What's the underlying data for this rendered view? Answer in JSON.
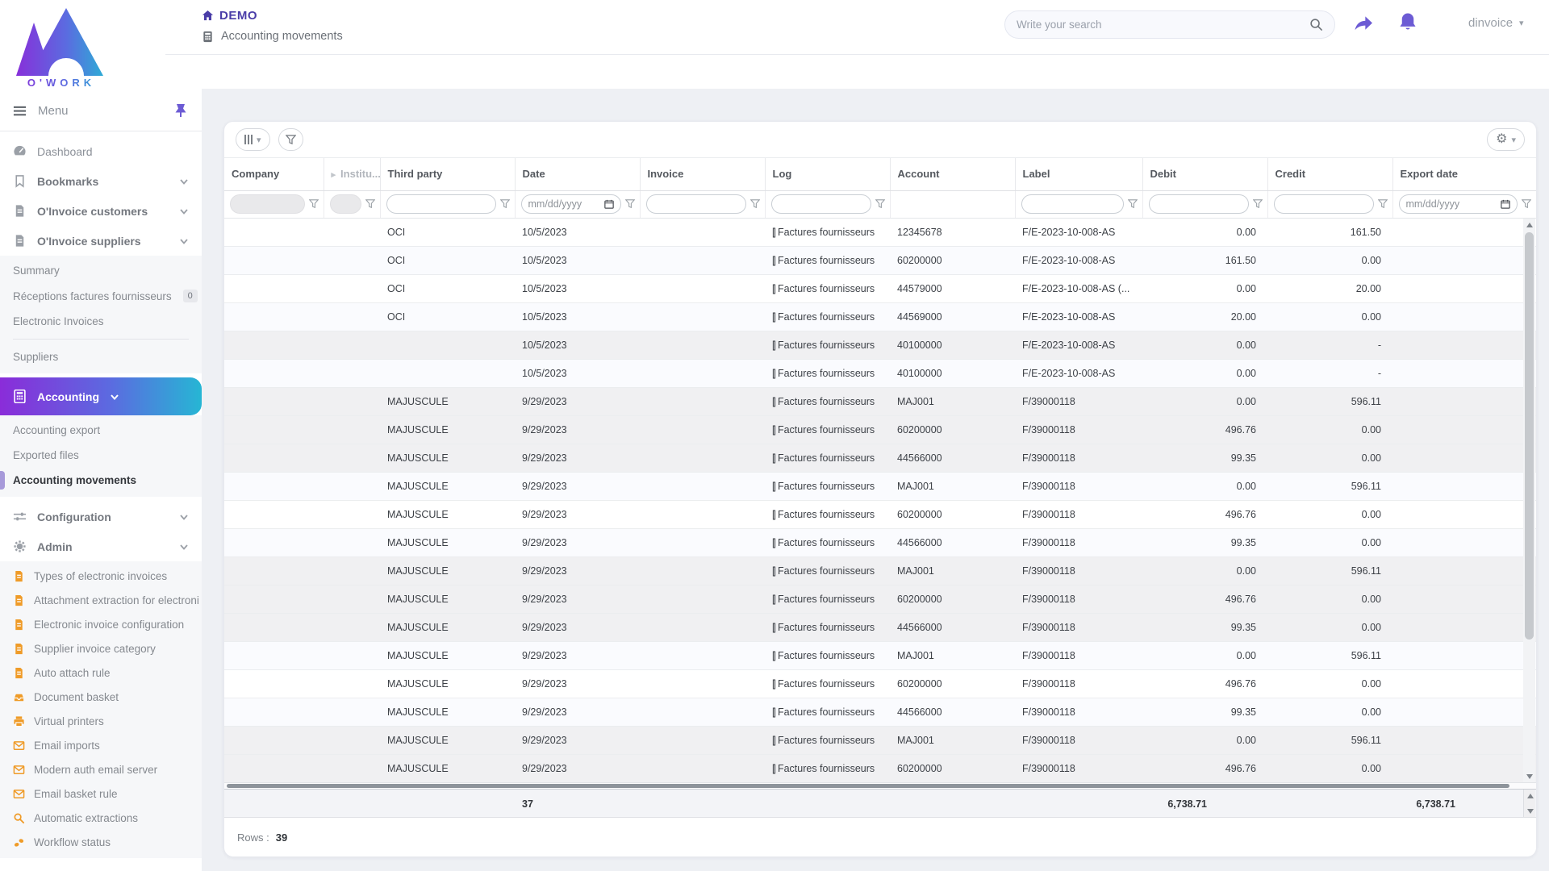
{
  "header": {
    "brand": "O'WORK",
    "app_title": "DEMO",
    "breadcrumb": "Accounting movements",
    "search_placeholder": "Write your search",
    "user": "dinvoice"
  },
  "icons": {
    "gear": "⚙",
    "expander": "▸",
    "caret_down": "▾"
  },
  "sidebar": {
    "menu_label": "Menu",
    "dashboard": "Dashboard",
    "bookmarks": "Bookmarks",
    "customers": "O'Invoice customers",
    "suppliers": "O'Invoice suppliers",
    "suppliers_sub": [
      "Summary",
      "Réceptions factures fournisseurs",
      "Electronic Invoices",
      "Suppliers"
    ],
    "receptions_badge": "0",
    "accounting": "Accounting",
    "accounting_sub": [
      "Accounting export",
      "Exported files",
      "Accounting movements"
    ],
    "configuration": "Configuration",
    "admin": "Admin",
    "admin_sub": [
      "Types of electronic invoices",
      "Attachment extraction for electroni",
      "Electronic invoice configuration",
      "Supplier invoice category",
      "Auto attach rule",
      "Document basket",
      "Virtual printers",
      "Email imports",
      "Modern auth email server",
      "Email basket rule",
      "Automatic extractions",
      "Workflow status"
    ]
  },
  "grid": {
    "columns": [
      "Company",
      "Institu...",
      "Third party",
      "Date",
      "Invoice",
      "Log",
      "Account",
      "Label",
      "Debit",
      "Credit",
      "Export date"
    ],
    "filters": {
      "date_placeholder": "mm/dd/yyyy"
    },
    "rows": [
      {
        "company": "",
        "institution": "",
        "third_party": "OCI",
        "date": "10/5/2023",
        "invoice": "",
        "log_prefix": "[]",
        "log": "Factures fournisseurs",
        "account": "12345678",
        "label": "F/E-2023-10-008-AS",
        "debit": "0.00",
        "credit": "161.50",
        "export_date": "",
        "bg": "white"
      },
      {
        "company": "",
        "institution": "",
        "third_party": "OCI",
        "date": "10/5/2023",
        "invoice": "",
        "log_prefix": "[]",
        "log": "Factures fournisseurs",
        "account": "60200000",
        "label": "F/E-2023-10-008-AS",
        "debit": "161.50",
        "credit": "0.00",
        "export_date": "",
        "bg": "alt"
      },
      {
        "company": "",
        "institution": "",
        "third_party": "OCI",
        "date": "10/5/2023",
        "invoice": "",
        "log_prefix": "[]",
        "log": "Factures fournisseurs",
        "account": "44579000",
        "label": "F/E-2023-10-008-AS (...",
        "debit": "0.00",
        "credit": "20.00",
        "export_date": "",
        "bg": "white"
      },
      {
        "company": "",
        "institution": "",
        "third_party": "OCI",
        "date": "10/5/2023",
        "invoice": "",
        "log_prefix": "[]",
        "log": "Factures fournisseurs",
        "account": "44569000",
        "label": "F/E-2023-10-008-AS",
        "debit": "20.00",
        "credit": "0.00",
        "export_date": "",
        "bg": "alt"
      },
      {
        "company": "",
        "institution": "",
        "third_party": "",
        "date": "10/5/2023",
        "invoice": "",
        "log_prefix": "[]",
        "log": "Factures fournisseurs",
        "account": "40100000",
        "label": "F/E-2023-10-008-AS",
        "debit": "0.00",
        "credit": "-",
        "export_date": "",
        "bg": "gray"
      },
      {
        "company": "",
        "institution": "",
        "third_party": "",
        "date": "10/5/2023",
        "invoice": "",
        "log_prefix": "[]",
        "log": "Factures fournisseurs",
        "account": "40100000",
        "label": "F/E-2023-10-008-AS",
        "debit": "0.00",
        "credit": "-",
        "export_date": "",
        "bg": "alt"
      },
      {
        "company": "",
        "institution": "",
        "third_party": "MAJUSCULE",
        "date": "9/29/2023",
        "invoice": "",
        "log_prefix": "[]",
        "log": "Factures fournisseurs",
        "account": "MAJ001",
        "label": "F/39000118",
        "debit": "0.00",
        "credit": "596.11",
        "export_date": "",
        "bg": "gray"
      },
      {
        "company": "",
        "institution": "",
        "third_party": "MAJUSCULE",
        "date": "9/29/2023",
        "invoice": "",
        "log_prefix": "[]",
        "log": "Factures fournisseurs",
        "account": "60200000",
        "label": "F/39000118",
        "debit": "496.76",
        "credit": "0.00",
        "export_date": "",
        "bg": "gray"
      },
      {
        "company": "",
        "institution": "",
        "third_party": "MAJUSCULE",
        "date": "9/29/2023",
        "invoice": "",
        "log_prefix": "[]",
        "log": "Factures fournisseurs",
        "account": "44566000",
        "label": "F/39000118",
        "debit": "99.35",
        "credit": "0.00",
        "export_date": "",
        "bg": "gray"
      },
      {
        "company": "",
        "institution": "",
        "third_party": "MAJUSCULE",
        "date": "9/29/2023",
        "invoice": "",
        "log_prefix": "[]",
        "log": "Factures fournisseurs",
        "account": "MAJ001",
        "label": "F/39000118",
        "debit": "0.00",
        "credit": "596.11",
        "export_date": "",
        "bg": "alt"
      },
      {
        "company": "",
        "institution": "",
        "third_party": "MAJUSCULE",
        "date": "9/29/2023",
        "invoice": "",
        "log_prefix": "[]",
        "log": "Factures fournisseurs",
        "account": "60200000",
        "label": "F/39000118",
        "debit": "496.76",
        "credit": "0.00",
        "export_date": "",
        "bg": "white"
      },
      {
        "company": "",
        "institution": "",
        "third_party": "MAJUSCULE",
        "date": "9/29/2023",
        "invoice": "",
        "log_prefix": "[]",
        "log": "Factures fournisseurs",
        "account": "44566000",
        "label": "F/39000118",
        "debit": "99.35",
        "credit": "0.00",
        "export_date": "",
        "bg": "alt"
      },
      {
        "company": "",
        "institution": "",
        "third_party": "MAJUSCULE",
        "date": "9/29/2023",
        "invoice": "",
        "log_prefix": "[]",
        "log": "Factures fournisseurs",
        "account": "MAJ001",
        "label": "F/39000118",
        "debit": "0.00",
        "credit": "596.11",
        "export_date": "",
        "bg": "gray"
      },
      {
        "company": "",
        "institution": "",
        "third_party": "MAJUSCULE",
        "date": "9/29/2023",
        "invoice": "",
        "log_prefix": "[]",
        "log": "Factures fournisseurs",
        "account": "60200000",
        "label": "F/39000118",
        "debit": "496.76",
        "credit": "0.00",
        "export_date": "",
        "bg": "gray"
      },
      {
        "company": "",
        "institution": "",
        "third_party": "MAJUSCULE",
        "date": "9/29/2023",
        "invoice": "",
        "log_prefix": "[]",
        "log": "Factures fournisseurs",
        "account": "44566000",
        "label": "F/39000118",
        "debit": "99.35",
        "credit": "0.00",
        "export_date": "",
        "bg": "gray"
      },
      {
        "company": "",
        "institution": "",
        "third_party": "MAJUSCULE",
        "date": "9/29/2023",
        "invoice": "",
        "log_prefix": "[]",
        "log": "Factures fournisseurs",
        "account": "MAJ001",
        "label": "F/39000118",
        "debit": "0.00",
        "credit": "596.11",
        "export_date": "",
        "bg": "alt"
      },
      {
        "company": "",
        "institution": "",
        "third_party": "MAJUSCULE",
        "date": "9/29/2023",
        "invoice": "",
        "log_prefix": "[]",
        "log": "Factures fournisseurs",
        "account": "60200000",
        "label": "F/39000118",
        "debit": "496.76",
        "credit": "0.00",
        "export_date": "",
        "bg": "white"
      },
      {
        "company": "",
        "institution": "",
        "third_party": "MAJUSCULE",
        "date": "9/29/2023",
        "invoice": "",
        "log_prefix": "[]",
        "log": "Factures fournisseurs",
        "account": "44566000",
        "label": "F/39000118",
        "debit": "99.35",
        "credit": "0.00",
        "export_date": "",
        "bg": "alt"
      },
      {
        "company": "",
        "institution": "",
        "third_party": "MAJUSCULE",
        "date": "9/29/2023",
        "invoice": "",
        "log_prefix": "[]",
        "log": "Factures fournisseurs",
        "account": "MAJ001",
        "label": "F/39000118",
        "debit": "0.00",
        "credit": "596.11",
        "export_date": "",
        "bg": "gray"
      },
      {
        "company": "",
        "institution": "",
        "third_party": "MAJUSCULE",
        "date": "9/29/2023",
        "invoice": "",
        "log_prefix": "[]",
        "log": "Factures fournisseurs",
        "account": "60200000",
        "label": "F/39000118",
        "debit": "496.76",
        "credit": "0.00",
        "export_date": "",
        "bg": "gray"
      }
    ],
    "footer": {
      "third_party_count": "37",
      "debit_total": "6,738.71",
      "credit_total": "6,738.71"
    },
    "rows_label": "Rows :",
    "rows_count": "39"
  },
  "colors": {
    "accent_purple": "#6c5bd4",
    "brand_gradient_start": "#8a2cd9",
    "brand_gradient_end": "#26b6d4",
    "admin_icon_orange": "#ef9b28",
    "title_indigo": "#4a3da8"
  }
}
